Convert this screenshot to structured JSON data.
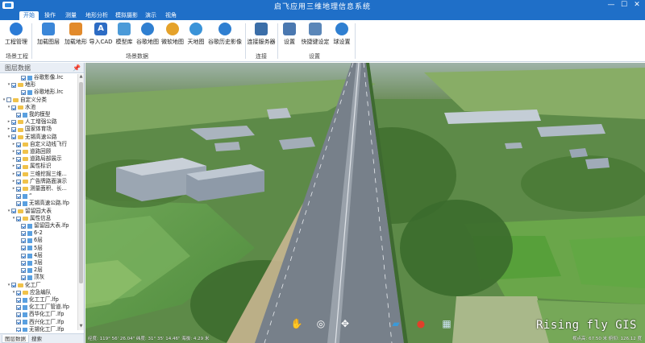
{
  "window": {
    "title": "启飞应用三维地理信息系统",
    "controls": {
      "minimize": "—",
      "maximize": "☐",
      "close": "✕"
    }
  },
  "menu": [
    "开始",
    "操作",
    "测量",
    "地形分析",
    "模拟摄影",
    "演示",
    "视角"
  ],
  "ribbon": {
    "buttons": [
      {
        "label": "工程管理",
        "icon": "project-icon",
        "color": "#2b7bd6"
      },
      {
        "label": "加载图层",
        "icon": "layer-add-icon",
        "color": "#3a86d8"
      },
      {
        "label": "加载地形",
        "icon": "terrain-icon",
        "color": "#e28a2b"
      },
      {
        "label": "导入CAD",
        "icon": "cad-icon",
        "color": "#2d6cc4"
      },
      {
        "label": "模型库",
        "icon": "model-library-icon",
        "color": "#4b9ad8"
      },
      {
        "label": "谷歌地图",
        "icon": "google-map-icon",
        "color": "#2f7fd1"
      },
      {
        "label": "微软地图",
        "icon": "ms-map-icon",
        "color": "#e5a22a"
      },
      {
        "label": "天地图",
        "icon": "tianditu-icon",
        "color": "#3a93d8"
      },
      {
        "label": "谷歌历史影像",
        "icon": "history-imagery-icon",
        "color": "#2f7fd1"
      },
      {
        "label": "连接服务器",
        "icon": "server-icon",
        "color": "#3b6ea8"
      },
      {
        "label": "设置",
        "icon": "settings-icon",
        "color": "#4a78b0"
      },
      {
        "label": "快捷键设定",
        "icon": "shortcut-icon",
        "color": "#5a86b8"
      },
      {
        "label": "球设置",
        "icon": "globe-settings-icon",
        "color": "#2f7fd1"
      }
    ],
    "groups": [
      "场景工程",
      "场景数据",
      "连接",
      "设置"
    ]
  },
  "panel": {
    "title": "图层数据",
    "pin": "📌",
    "tabs": [
      "图层数据",
      "搜索"
    ],
    "tree": [
      {
        "label": "谷歌影像.lrc",
        "level": 3,
        "type": "file",
        "checked": true,
        "expander": ""
      },
      {
        "label": "地形",
        "level": 1,
        "type": "folder",
        "checked": true,
        "expander": "▾"
      },
      {
        "label": "谷歌地形.lrc",
        "level": 3,
        "type": "file",
        "checked": true,
        "expander": ""
      },
      {
        "label": "自定义分类",
        "level": 0,
        "type": "folder",
        "checked": false,
        "expander": "▾"
      },
      {
        "label": "水池",
        "level": 1,
        "type": "folder",
        "checked": true,
        "expander": "▾"
      },
      {
        "label": "我的模型",
        "level": 2,
        "type": "file",
        "checked": true,
        "expander": ""
      },
      {
        "label": "人工增强公路",
        "level": 1,
        "type": "folder",
        "checked": true,
        "expander": "▸"
      },
      {
        "label": "国家体育场",
        "level": 1,
        "type": "folder",
        "checked": true,
        "expander": "▸"
      },
      {
        "label": "无锡高速公路",
        "level": 1,
        "type": "folder",
        "checked": true,
        "expander": "▾"
      },
      {
        "label": "自定义动线飞行",
        "level": 2,
        "type": "folder",
        "checked": true,
        "expander": "▸"
      },
      {
        "label": "道路回顾",
        "level": 2,
        "type": "folder",
        "checked": true,
        "expander": "▸"
      },
      {
        "label": "道路局部展示",
        "level": 2,
        "type": "folder",
        "checked": true,
        "expander": "▸"
      },
      {
        "label": "属性标识",
        "level": 2,
        "type": "folder",
        "checked": true,
        "expander": "▸"
      },
      {
        "label": "三维挖掘三维...",
        "level": 2,
        "type": "folder",
        "checked": true,
        "expander": "▸"
      },
      {
        "label": "广告牌路面演示",
        "level": 2,
        "type": "folder",
        "checked": true,
        "expander": "▸"
      },
      {
        "label": "测量面积、长...",
        "level": 2,
        "type": "folder",
        "checked": true,
        "expander": "▸"
      },
      {
        "label": "“",
        "level": 2,
        "type": "file",
        "checked": true,
        "expander": ""
      },
      {
        "label": "无锡高速公路.lfp",
        "level": 2,
        "type": "file",
        "checked": true,
        "expander": ""
      },
      {
        "label": "留留园大表",
        "level": 1,
        "type": "folder",
        "checked": true,
        "expander": "▾"
      },
      {
        "label": "属性信息",
        "level": 2,
        "type": "folder",
        "checked": true,
        "expander": "▾"
      },
      {
        "label": "留留园大表.lfp",
        "level": 3,
        "type": "file",
        "checked": true,
        "expander": ""
      },
      {
        "label": "6-2",
        "level": 3,
        "type": "file",
        "checked": true,
        "expander": ""
      },
      {
        "label": "6层",
        "level": 3,
        "type": "file",
        "checked": true,
        "expander": ""
      },
      {
        "label": "5层",
        "level": 3,
        "type": "file",
        "checked": true,
        "expander": ""
      },
      {
        "label": "4层",
        "level": 3,
        "type": "file",
        "checked": true,
        "expander": ""
      },
      {
        "label": "3层",
        "level": 3,
        "type": "file",
        "checked": true,
        "expander": ""
      },
      {
        "label": "2层",
        "level": 3,
        "type": "file",
        "checked": true,
        "expander": ""
      },
      {
        "label": "顶灰",
        "level": 3,
        "type": "file",
        "checked": true,
        "expander": ""
      },
      {
        "label": "化工厂",
        "level": 1,
        "type": "folder",
        "checked": true,
        "expander": "▾"
      },
      {
        "label": "应急编队",
        "level": 2,
        "type": "folder",
        "checked": true,
        "expander": "▾"
      },
      {
        "label": "化工工厂.lfp",
        "level": 2,
        "type": "file",
        "checked": true,
        "expander": ""
      },
      {
        "label": "化工工厂管道.lfp",
        "level": 2,
        "type": "file",
        "checked": true,
        "expander": ""
      },
      {
        "label": "西华化工厂.lfp",
        "level": 2,
        "type": "file",
        "checked": true,
        "expander": ""
      },
      {
        "label": "西兴化工厂.lfp",
        "level": 2,
        "type": "file",
        "checked": true,
        "expander": ""
      },
      {
        "label": "无锡化工厂.lfp",
        "level": 2,
        "type": "file",
        "checked": true,
        "expander": ""
      }
    ]
  },
  "scene": {
    "watermark": "Rising fly GIS",
    "status_left": "经度: 119° 56' 26.04\"  纬度: 31° 35' 14.46\"  海拔: 4.29 米",
    "status_right": "视点高: 67.50 米  俯仰: 126.12 度",
    "nav_tools": [
      {
        "icon": "pan-hand-icon",
        "glyph": "✋"
      },
      {
        "icon": "globe-nav-icon",
        "glyph": "◎"
      },
      {
        "icon": "move-arrows-icon",
        "glyph": "✥"
      },
      {
        "icon": "shape-tool-icon",
        "glyph": "▰"
      },
      {
        "icon": "map-pin-icon",
        "glyph": "●"
      },
      {
        "icon": "buildings-icon",
        "glyph": "▦"
      }
    ]
  }
}
